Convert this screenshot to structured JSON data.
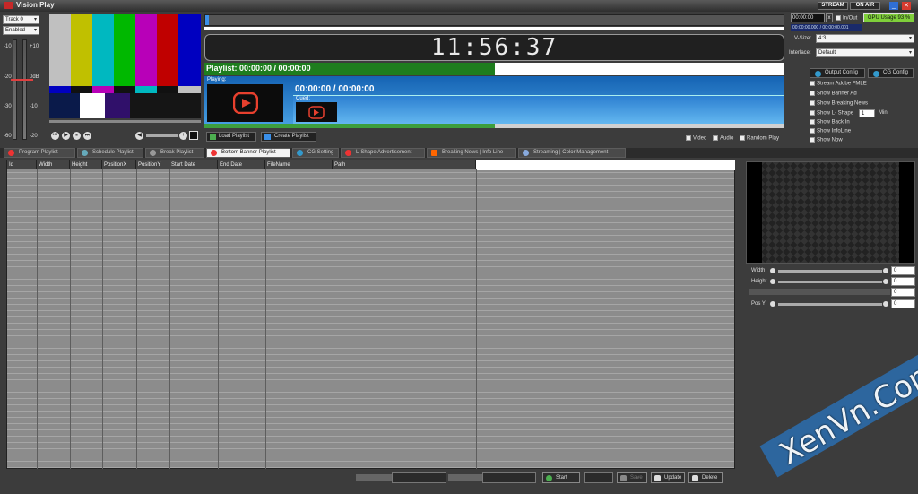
{
  "window": {
    "title": "Vision Play",
    "stream_label": "STREAM",
    "onair_label": "ON AIR",
    "minimize": "_",
    "close": "✕"
  },
  "left": {
    "track": "Track 0",
    "enabled": "Enabled",
    "db_labels": [
      "-10",
      "-20",
      "-30",
      "-60",
      "+10",
      "0dB",
      "-10",
      "-20"
    ]
  },
  "transport": {
    "clock": "11:56:37",
    "timecode_in": "00:00:00",
    "timecode_x": "x",
    "inout_label": "In/Out",
    "gpu": "GPU Usage 93 %",
    "timecode_range": "00:00:00.000 / 00:00:00.001"
  },
  "video": {
    "vsize_label": "V-Size:",
    "vsize_value": "4:3",
    "interlace_label": "Interlace:",
    "interlace_value": "Default",
    "output_config": "Output Config",
    "cg_config": "CG Config"
  },
  "options": {
    "stream_adobe": "Stream Adobe FMLE",
    "show_banner": "Show Banner Ad",
    "show_breaking": "Show Breaking News",
    "show_lshape": "Show L- Shape",
    "lshape_value": "1",
    "lshape_unit": "Min",
    "show_backin": "Show Back In",
    "show_infoline": "Show InfoLine",
    "show_now": "Show Now"
  },
  "playlist": {
    "title": "Playlist: 00:00:00 / 00:00:00",
    "playing_label": "Playing:",
    "time": "00:00:00 / 00:00:00",
    "cued_label": "Cued:",
    "load_button": "Load Playlist",
    "create_button": "Create Playlist",
    "video_check": "Video",
    "audio_check": "Audio",
    "random_check": "Random Play"
  },
  "tabs": [
    "Program Playlist",
    "Schedule Playlist",
    "Break Playlist",
    "Bottom Banner Playlist",
    "CG Setting",
    "L-Shape Advertisement",
    "Breaking News | Info Line",
    "Streaming | Color Management"
  ],
  "table": {
    "columns": [
      "Id",
      "Width",
      "Height",
      "PositionX",
      "PositionY",
      "Start Date",
      "End Date",
      "FileName",
      "Path"
    ]
  },
  "props": {
    "width_label": "Width",
    "height_label": "Height",
    "posy_label": "Pos Y",
    "width_value": "0",
    "height_value": "0",
    "posx_value": "0",
    "posy_value": "0"
  },
  "bottom": {
    "start": "Start",
    "save": "Save",
    "update": "Update",
    "delete": "Delete"
  },
  "watermark": "XenVn.Com",
  "colors": {
    "accent_green": "#1e7d1e",
    "accent_blue": "#1563b3",
    "gpu_green": "#7fcf3a"
  }
}
